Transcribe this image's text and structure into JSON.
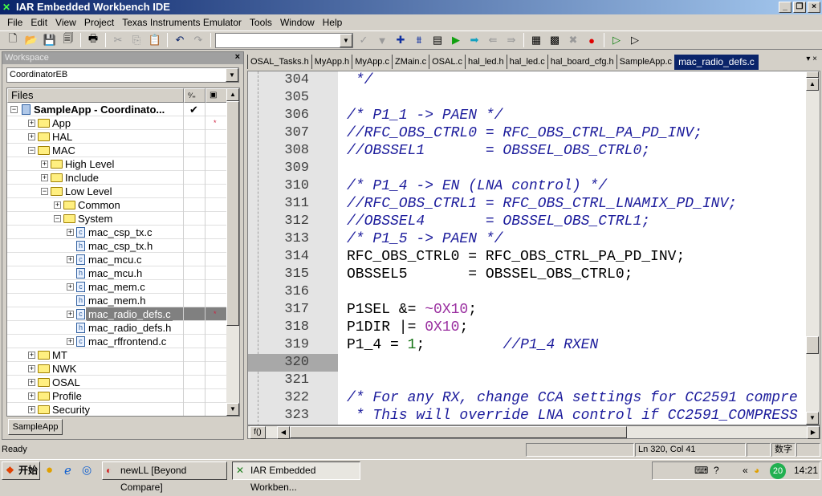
{
  "window": {
    "title": "IAR Embedded Workbench IDE"
  },
  "menu": [
    "File",
    "Edit",
    "View",
    "Project",
    "Texas Instruments Emulator",
    "Tools",
    "Window",
    "Help"
  ],
  "toolbar": {
    "combo_value": ""
  },
  "workspace": {
    "title": "Workspace",
    "config": "CoordinatorEB",
    "files_header": "Files",
    "tab": "SampleApp",
    "tree": [
      {
        "label": "SampleApp - Coordinato...",
        "level": 0,
        "type": "project",
        "exp": "-",
        "check": "✔",
        "bold": true
      },
      {
        "label": "App",
        "level": 1,
        "type": "folder",
        "exp": "+",
        "mark": "*"
      },
      {
        "label": "HAL",
        "level": 1,
        "type": "folder",
        "exp": "+"
      },
      {
        "label": "MAC",
        "level": 1,
        "type": "folder",
        "exp": "-"
      },
      {
        "label": "High Level",
        "level": 2,
        "type": "folder",
        "exp": "+"
      },
      {
        "label": "Include",
        "level": 2,
        "type": "folder",
        "exp": "+"
      },
      {
        "label": "Low Level",
        "level": 2,
        "type": "folder",
        "exp": "-"
      },
      {
        "label": "Common",
        "level": 3,
        "type": "folder",
        "exp": "+"
      },
      {
        "label": "System",
        "level": 3,
        "type": "folder",
        "exp": "-"
      },
      {
        "label": "mac_csp_tx.c",
        "level": 4,
        "type": "c",
        "exp": "+"
      },
      {
        "label": "mac_csp_tx.h",
        "level": 4,
        "type": "h"
      },
      {
        "label": "mac_mcu.c",
        "level": 4,
        "type": "c",
        "exp": "+"
      },
      {
        "label": "mac_mcu.h",
        "level": 4,
        "type": "h"
      },
      {
        "label": "mac_mem.c",
        "level": 4,
        "type": "c",
        "exp": "+"
      },
      {
        "label": "mac_mem.h",
        "level": 4,
        "type": "h"
      },
      {
        "label": "mac_radio_defs.c",
        "level": 4,
        "type": "c",
        "exp": "+",
        "selected": true,
        "mark": "*"
      },
      {
        "label": "mac_radio_defs.h",
        "level": 4,
        "type": "h"
      },
      {
        "label": "mac_rffrontend.c",
        "level": 4,
        "type": "c",
        "exp": "+"
      },
      {
        "label": "MT",
        "level": 1,
        "type": "folder",
        "exp": "+"
      },
      {
        "label": "NWK",
        "level": 1,
        "type": "folder",
        "exp": "+"
      },
      {
        "label": "OSAL",
        "level": 1,
        "type": "folder",
        "exp": "+"
      },
      {
        "label": "Profile",
        "level": 1,
        "type": "folder",
        "exp": "+"
      },
      {
        "label": "Security",
        "level": 1,
        "type": "folder",
        "exp": "+"
      }
    ]
  },
  "editor": {
    "tabs": [
      "OSAL_Tasks.h",
      "MyApp.h",
      "MyApp.c",
      "ZMain.c",
      "OSAL.c",
      "hal_led.h",
      "hal_led.c",
      "hal_board_cfg.h",
      "SampleApp.c",
      "mac_radio_defs.c"
    ],
    "active_tab": "mac_radio_defs.c",
    "current_line": 320,
    "lines": [
      {
        "n": "304",
        "parts": [
          {
            "c": "cm",
            "t": " */"
          }
        ]
      },
      {
        "n": "305",
        "parts": []
      },
      {
        "n": "306",
        "parts": [
          {
            "c": "cm",
            "t": "/* P1_1 -> PAEN */"
          }
        ]
      },
      {
        "n": "307",
        "parts": [
          {
            "c": "cm",
            "t": "//RFC_OBS_CTRL0 = RFC_OBS_CTRL_PA_PD_INV;"
          }
        ]
      },
      {
        "n": "308",
        "parts": [
          {
            "c": "cm",
            "t": "//OBSSEL1       = OBSSEL_OBS_CTRL0;"
          }
        ]
      },
      {
        "n": "309",
        "parts": []
      },
      {
        "n": "310",
        "parts": [
          {
            "c": "cm",
            "t": "/* P1_4 -> EN (LNA control) */"
          }
        ]
      },
      {
        "n": "311",
        "parts": [
          {
            "c": "cm",
            "t": "//RFC_OBS_CTRL1 = RFC_OBS_CTRL_LNAMIX_PD_INV;"
          }
        ]
      },
      {
        "n": "312",
        "parts": [
          {
            "c": "cm",
            "t": "//OBSSEL4       = OBSSEL_OBS_CTRL1;"
          }
        ]
      },
      {
        "n": "313",
        "parts": [
          {
            "c": "cm",
            "t": "/* P1_5 -> PAEN */"
          }
        ]
      },
      {
        "n": "314",
        "parts": [
          {
            "c": "",
            "t": "RFC_OBS_CTRL0 = RFC_OBS_CTRL_PA_PD_INV;"
          }
        ]
      },
      {
        "n": "315",
        "parts": [
          {
            "c": "",
            "t": "OBSSEL5       = OBSSEL_OBS_CTRL0;"
          }
        ]
      },
      {
        "n": "316",
        "parts": []
      },
      {
        "n": "317",
        "parts": [
          {
            "c": "",
            "t": "P1SEL &= "
          },
          {
            "c": "num",
            "t": "~0X10"
          },
          {
            "c": "",
            "t": ";"
          }
        ]
      },
      {
        "n": "318",
        "parts": [
          {
            "c": "",
            "t": "P1DIR |= "
          },
          {
            "c": "num",
            "t": "0X10"
          },
          {
            "c": "",
            "t": ";"
          }
        ]
      },
      {
        "n": "319",
        "parts": [
          {
            "c": "",
            "t": "P1_4 = "
          },
          {
            "c": "lit",
            "t": "1"
          },
          {
            "c": "",
            "t": ";         "
          },
          {
            "c": "cm",
            "t": "//P1_4 RXEN"
          }
        ]
      },
      {
        "n": "320",
        "parts": []
      },
      {
        "n": "321",
        "parts": []
      },
      {
        "n": "322",
        "parts": [
          {
            "c": "cm",
            "t": "/* For any RX, change CCA settings for CC2591 compre"
          }
        ]
      },
      {
        "n": "323",
        "parts": [
          {
            "c": "cm",
            "t": " * This will override LNA control if CC2591_COMPRESS"
          }
        ]
      }
    ],
    "fn_button": "f()"
  },
  "status": {
    "ready": "Ready",
    "position": "Ln 320, Col 41",
    "ime": "数字"
  },
  "taskbar": {
    "start": "开始",
    "tasks": [
      "newLL  [Beyond Compare]",
      "IAR Embedded Workben..."
    ],
    "clock": "14:21",
    "badge": "20"
  },
  "colors": {
    "comment": "#1c1c9c",
    "number": "#9a2fa0",
    "literal": "#107010",
    "active_tab": "#0a246a"
  }
}
